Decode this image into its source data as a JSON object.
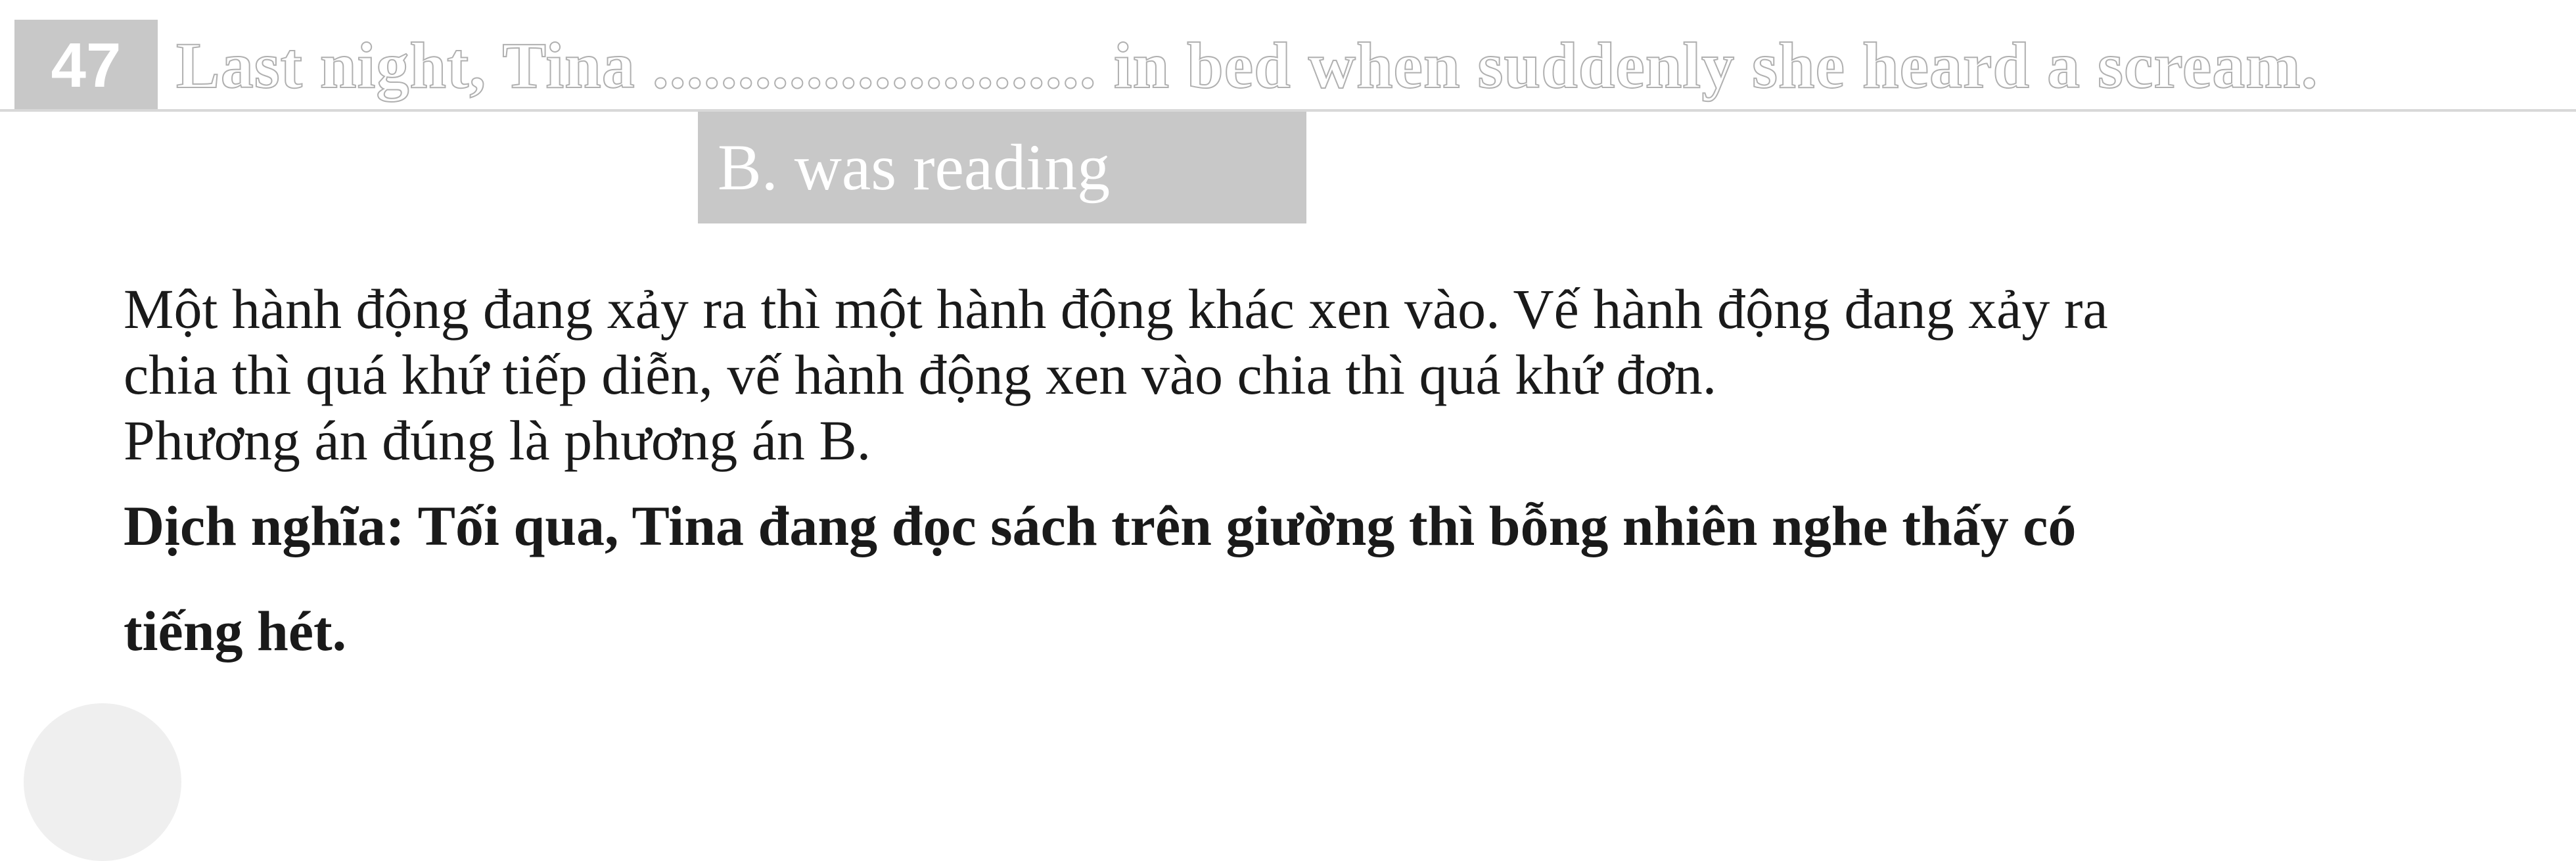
{
  "question": {
    "number": "47",
    "text": "Last night, Tina .......................... in bed when suddenly she heard a scream."
  },
  "answer": {
    "label": "B. was reading"
  },
  "explanation": {
    "lines": [
      "Một hành động đang xảy ra thì một hành động khác xen vào. Vế hành động đang xảy ra",
      "chia thì quá khứ tiếp diễn, vế hành động xen vào chia thì quá khứ đơn.",
      "Phương án đúng là phương án B."
    ]
  },
  "translation": {
    "lines": [
      "Dịch nghĩa: Tối qua, Tina đang đọc sách trên giường thì bỗng nhiên nghe thấy có",
      "tiếng hét."
    ]
  }
}
